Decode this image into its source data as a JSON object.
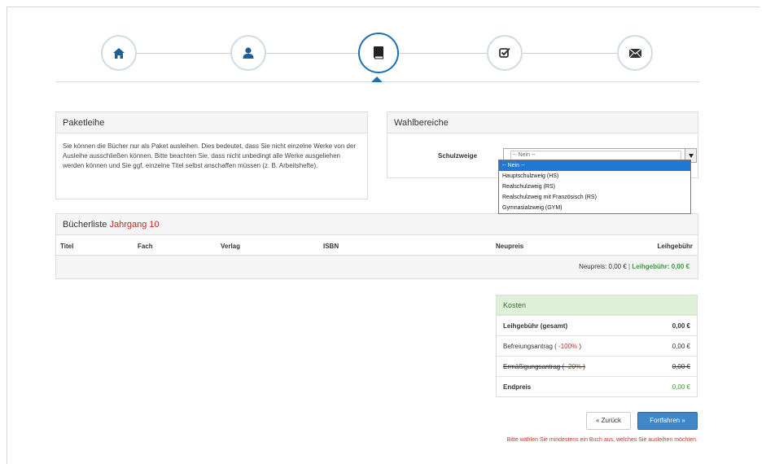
{
  "stepper": {
    "steps": [
      {
        "icon": "home-icon"
      },
      {
        "icon": "user-icon"
      },
      {
        "icon": "book-icon",
        "active": true
      },
      {
        "icon": "checkbox-icon"
      },
      {
        "icon": "envelope-icon"
      }
    ]
  },
  "paketleihe": {
    "title": "Paketleihe",
    "text": "Sie können die Bücher nur als Paket ausleihen. Dies bedeutet, dass Sie nicht einzelne Werke von der Ausleihe ausschließen können. Bitte beachten Sie, dass nicht unbedingt alle Werke ausgeliehen werden können und Sie ggf. einzelne Titel selbst anschaffen müssen (z. B. Arbeitshefte)."
  },
  "wahlbereiche": {
    "title": "Wahlbereiche",
    "label": "Schulzweige",
    "selected": "-- Nein --",
    "options": [
      "-- Nein --",
      "Hauptschulzweig (HS)",
      "Realschulzweig (RS)",
      "Realschulzweig mit Französisch (RS)",
      "Gymnasialzweig (GYM)"
    ]
  },
  "buecherliste": {
    "title": "Bücherliste",
    "jahrgang": "Jahrgang 10",
    "columns": [
      "Titel",
      "Fach",
      "Verlag",
      "ISBN",
      "Neupreis",
      "Leihgebühr"
    ],
    "summary_neupreis": "Neupreis: 0,00 €",
    "summary_sep": "|",
    "summary_leih": "Leihgebühr: 0,00 €"
  },
  "kosten": {
    "title": "Kosten",
    "rows": [
      {
        "label": "Leihgebühr (gesamt)",
        "value": "0,00 €"
      },
      {
        "label_pre": "Befreiungsantrag ( ",
        "label_pct": "-100%",
        "label_post": " )",
        "value": "0,00 €"
      },
      {
        "label_pre": "Ermäßigungsantrag ( ",
        "label_pct": "-20%",
        "label_post": " )",
        "value": "0,00 €"
      },
      {
        "label": "Endpreis",
        "value": "0,00 €"
      }
    ]
  },
  "buttons": {
    "back": "« Zurück",
    "next": "Fortfahren »"
  },
  "warning": "Bitte wählen Sie mindestens ein Buch aus, welches Sie ausleihen möchten.",
  "colors": {
    "accent": "#1f6fb2",
    "danger": "#b9302a",
    "success": "#3a9a3a",
    "primary_button": "#3f87c9"
  }
}
